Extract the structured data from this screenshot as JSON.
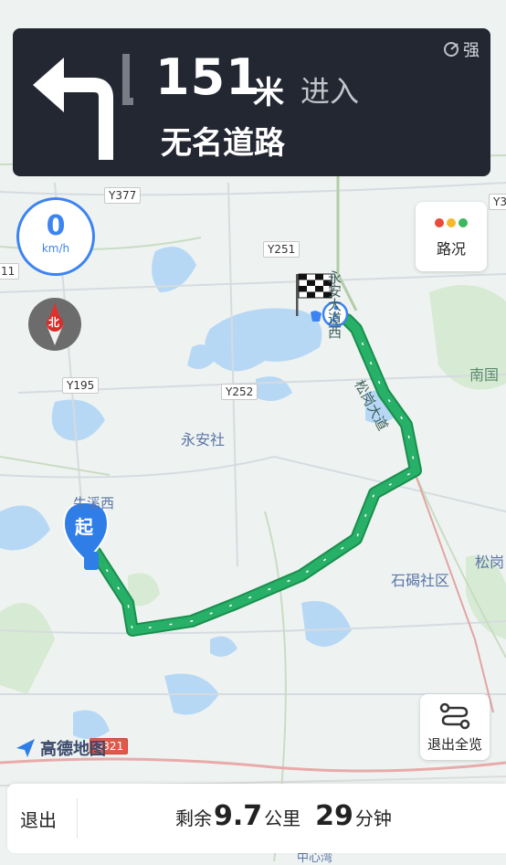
{
  "banner": {
    "distance": "151",
    "distance_unit": "米",
    "action": "进入",
    "road_name": "无名道路",
    "signal_text": "强"
  },
  "speed": {
    "value": "0",
    "unit": "km/h"
  },
  "compass": {
    "label": "北"
  },
  "traffic": {
    "label": "路况"
  },
  "overview": {
    "label": "退出全览"
  },
  "logo": {
    "text": "高德地图"
  },
  "bottom": {
    "exit_label": "退出",
    "remaining_prefix": "剩余",
    "distance": "9.7",
    "distance_unit": "公里",
    "time": "29",
    "time_unit": "分钟"
  },
  "map": {
    "start_marker": "起",
    "labels": [
      "永安社",
      "石碣社区",
      "牛溪西",
      "南国",
      "松岗",
      "中心湾"
    ],
    "roads": [
      "Y377",
      "Y251",
      "Y195",
      "Y252",
      "G321",
      "永安大道西",
      "松岗大道",
      "Y3",
      "11"
    ]
  },
  "colors": {
    "route": "#1fa35a",
    "accent": "#3d84f0",
    "banner": "#232732"
  }
}
